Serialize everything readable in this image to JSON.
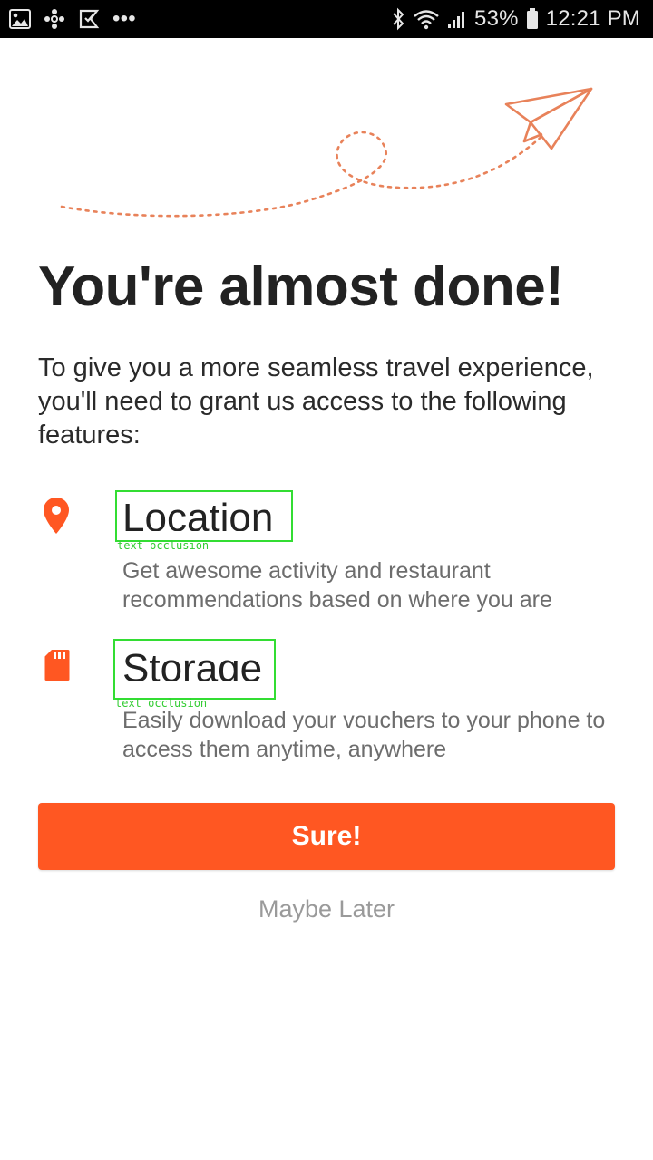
{
  "status_bar": {
    "left_icons": [
      "gallery-icon",
      "pinwheel-icon",
      "flag-icon",
      "more-dots-icon"
    ],
    "more": "•••",
    "battery": "53%",
    "time": "12:21 PM"
  },
  "colors": {
    "accent": "#ff5722",
    "title": "#222222",
    "body": "#2a2a2a",
    "muted": "#6d6d6d",
    "link_gray": "#9a9a9a",
    "status_bar_bg": "#000000",
    "annotation_green": "#33dd33"
  },
  "main": {
    "title": "You're almost done!",
    "intro": "To give you a more seamless travel experience, you'll need to grant us access to the following features:",
    "features": [
      {
        "icon": "location-pin-icon",
        "name": "Location",
        "description": "Get awesome activity and restaurant recommendations based on where you are",
        "annotation": "text occlusion"
      },
      {
        "icon": "sd-card-icon",
        "name": "Storage",
        "description": "Easily download your vouchers to your phone to access them anytime, anywhere",
        "annotation": "text occlusion"
      }
    ],
    "primary_button": "Sure!",
    "secondary_button": "Maybe Later"
  }
}
